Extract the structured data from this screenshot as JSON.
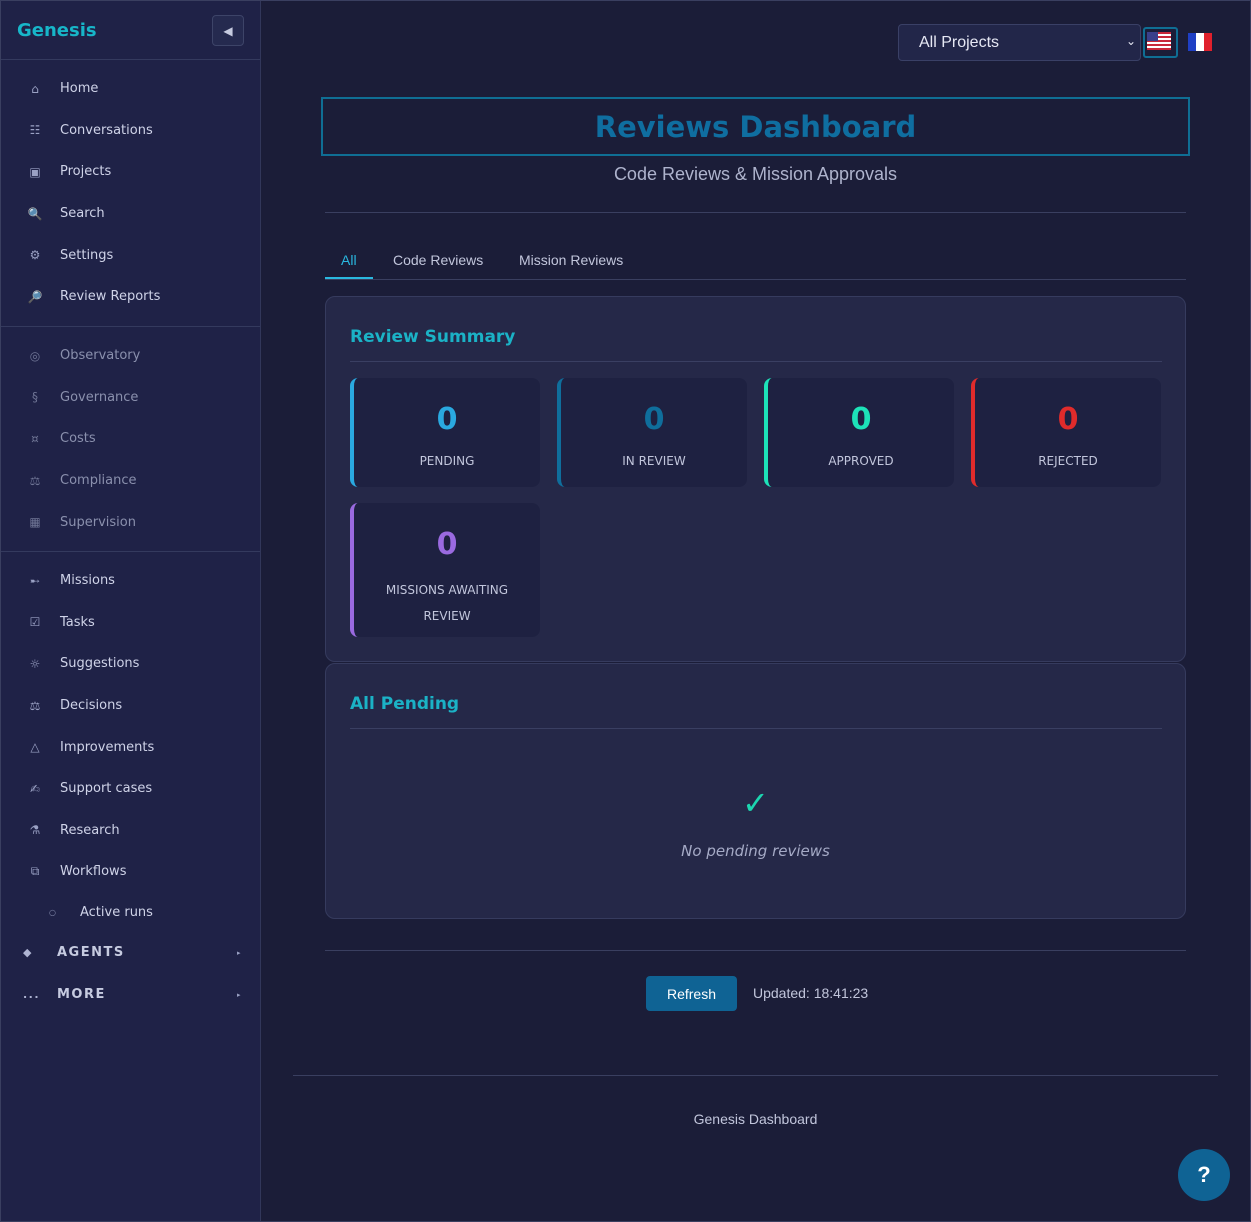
{
  "sidebar": {
    "brand": "Genesis",
    "collapse_icon": "◀",
    "primary": [
      {
        "icon": "⌂",
        "label": "Home"
      },
      {
        "icon": "☷",
        "label": "Conversations"
      },
      {
        "icon": "▣",
        "label": "Projects"
      },
      {
        "icon": "🔍",
        "label": "Search"
      },
      {
        "icon": "⚙",
        "label": "Settings"
      },
      {
        "icon": "🔎",
        "label": "Review Reports"
      }
    ],
    "secondary": [
      {
        "icon": "◎",
        "label": "Observatory"
      },
      {
        "icon": "§",
        "label": "Governance"
      },
      {
        "icon": "¤",
        "label": "Costs"
      },
      {
        "icon": "⚖",
        "label": "Compliance"
      },
      {
        "icon": "▦",
        "label": "Supervision"
      }
    ],
    "work": [
      {
        "icon": "➸",
        "label": "Missions"
      },
      {
        "icon": "☑",
        "label": "Tasks"
      },
      {
        "icon": "☼",
        "label": "Suggestions"
      },
      {
        "icon": "⚖",
        "label": "Decisions"
      },
      {
        "icon": "△",
        "label": "Improvements"
      },
      {
        "icon": "✍",
        "label": "Support cases"
      },
      {
        "icon": "⚗",
        "label": "Research"
      },
      {
        "icon": "⧉",
        "label": "Workflows"
      }
    ],
    "sub_item": {
      "icon": "○",
      "label": "Active runs"
    },
    "sections": [
      {
        "icon": "◆",
        "label": "AGENTS",
        "caret": "▸"
      },
      {
        "icon": "...",
        "label": "MORE",
        "caret": "▸"
      }
    ]
  },
  "topbar": {
    "project_select": "All Projects",
    "project_chevron": "⌄"
  },
  "header": {
    "title": "Reviews Dashboard",
    "subtitle": "Code Reviews & Mission Approvals"
  },
  "tabs": [
    "All",
    "Code Reviews",
    "Mission Reviews"
  ],
  "summary": {
    "title": "Review Summary",
    "stats": [
      {
        "value": "0",
        "label": "PENDING",
        "color": "#2aa9e0"
      },
      {
        "value": "0",
        "label": "IN REVIEW",
        "color": "#0f6e9c"
      },
      {
        "value": "0",
        "label": "APPROVED",
        "color": "#1de2b8"
      },
      {
        "value": "0",
        "label": "REJECTED",
        "color": "#e02b2b"
      },
      {
        "value": "0",
        "label": "MISSIONS AWAITING REVIEW",
        "color": "#9a6ae0"
      }
    ]
  },
  "pending": {
    "title": "All Pending",
    "check": "✓",
    "empty": "No pending reviews"
  },
  "footer_bar": {
    "refresh": "Refresh",
    "updated": "Updated: 18:41:23"
  },
  "footer": "Genesis Dashboard",
  "help": "?"
}
